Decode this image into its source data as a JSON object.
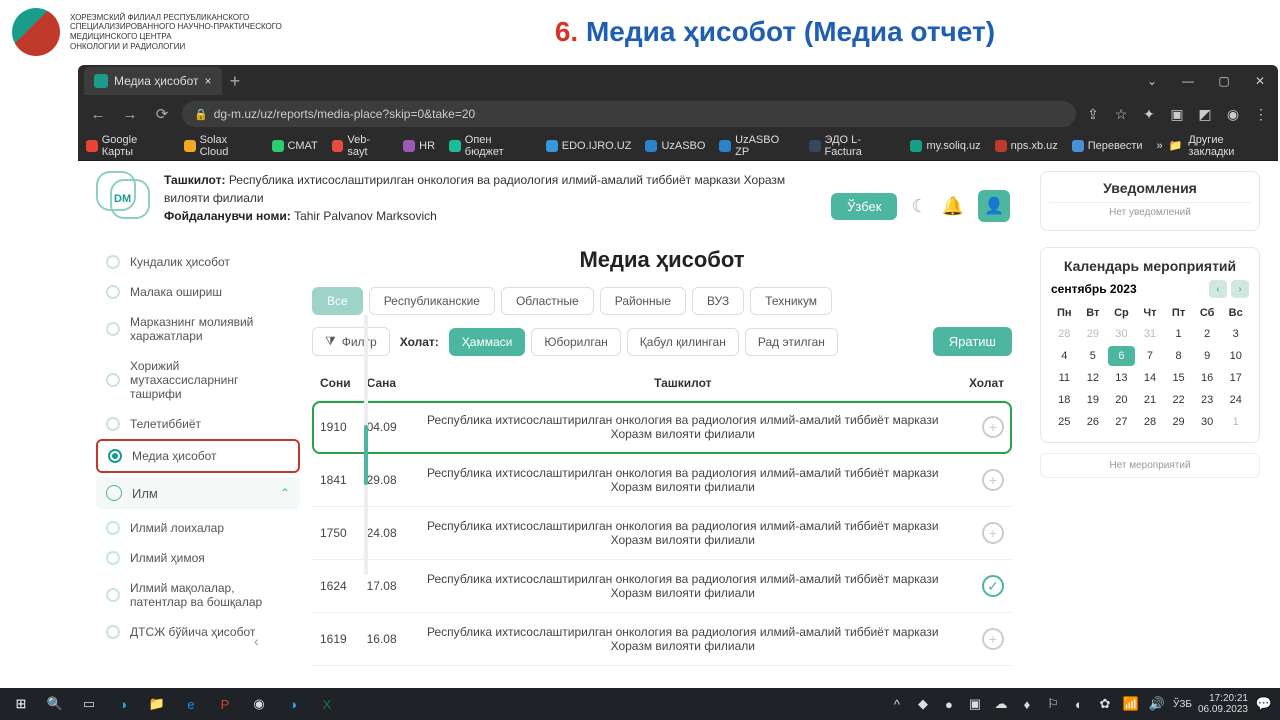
{
  "doc": {
    "org_lines": "ХОРЕЗМСКИЙ ФИЛИАЛ РЕСПУБЛИКАНСКОГО\nСПЕЦИАЛИЗИРОВАННОГО НАУЧНО-ПРАКТИЧЕСКОГО\nМЕДИЦИНСКОГО ЦЕНТРА\nОНКОЛОГИИ И РАДИОЛОГИИ",
    "title_num": "6.",
    "title": "Медиа ҳисобот (Медиа отчет)"
  },
  "browser": {
    "tab_title": "Медиа ҳисобот",
    "url": "dg-m.uz/uz/reports/media-place?skip=0&take=20",
    "bookmarks": [
      {
        "label": "Google Карты",
        "color": "#ea4335"
      },
      {
        "label": "Solax Cloud",
        "color": "#f5a623"
      },
      {
        "label": "СМАТ",
        "color": "#2ecc71"
      },
      {
        "label": "Veb-sayt",
        "color": "#e74c3c"
      },
      {
        "label": "HR",
        "color": "#9b59b6"
      },
      {
        "label": "Опен бюджет",
        "color": "#1abc9c"
      },
      {
        "label": "EDO.IJRO.UZ",
        "color": "#3498db"
      },
      {
        "label": "UzASBO",
        "color": "#2c82c9"
      },
      {
        "label": "UzASBO ZP",
        "color": "#2c82c9"
      },
      {
        "label": "ЭДО L-Factura",
        "color": "#34495e"
      },
      {
        "label": "my.soliq.uz",
        "color": "#16a085"
      },
      {
        "label": "nps.xb.uz",
        "color": "#c0392b"
      },
      {
        "label": "Перевести",
        "color": "#4a90d9"
      }
    ],
    "other_bookmarks": "Другие закладки"
  },
  "app": {
    "org_label": "Ташкилот:",
    "org_value": "Республика ихтисослаштирилган онкология ва радиология илмий-амалий тиббиёт маркази Хоразм вилояти филиали",
    "user_label": "Фойдаланувчи номи:",
    "user_value": "Tahir Palvanov Marksovich",
    "lang": "Ўзбек",
    "notif_title": "Уведомления",
    "notif_empty": "Нет уведомлений",
    "cal_title": "Календарь мероприятий",
    "cal_month": "сентябрь 2023",
    "cal_dow": [
      "Пн",
      "Вт",
      "Ср",
      "Чт",
      "Пт",
      "Сб",
      "Вс"
    ],
    "cal_days": [
      {
        "n": "28",
        "mute": true
      },
      {
        "n": "29",
        "mute": true
      },
      {
        "n": "30",
        "mute": true
      },
      {
        "n": "31",
        "mute": true
      },
      {
        "n": "1"
      },
      {
        "n": "2"
      },
      {
        "n": "3"
      },
      {
        "n": "4"
      },
      {
        "n": "5"
      },
      {
        "n": "6",
        "today": true
      },
      {
        "n": "7"
      },
      {
        "n": "8"
      },
      {
        "n": "9"
      },
      {
        "n": "10"
      },
      {
        "n": "11"
      },
      {
        "n": "12"
      },
      {
        "n": "13"
      },
      {
        "n": "14"
      },
      {
        "n": "15"
      },
      {
        "n": "16"
      },
      {
        "n": "17"
      },
      {
        "n": "18"
      },
      {
        "n": "19"
      },
      {
        "n": "20"
      },
      {
        "n": "21"
      },
      {
        "n": "22"
      },
      {
        "n": "23"
      },
      {
        "n": "24"
      },
      {
        "n": "25"
      },
      {
        "n": "26"
      },
      {
        "n": "27"
      },
      {
        "n": "28"
      },
      {
        "n": "29"
      },
      {
        "n": "30"
      },
      {
        "n": "1",
        "mute": true
      }
    ],
    "cal_empty": "Нет мероприятий"
  },
  "sidebar": {
    "items_top": [
      "Кундалик ҳисобот",
      "Малака ошириш",
      "Марказнинг молиявий харажатлари",
      "Хорижий мутахассисларнинг ташрифи",
      "Телетиббиёт",
      "Медиа ҳисобот"
    ],
    "group": "Илм",
    "items_sub": [
      "Илмий лоихалар",
      "Илмий ҳимоя",
      "Илмий мақолалар, патентлар ва бошқалар",
      "ДТСЖ бўйича ҳисобот"
    ]
  },
  "main": {
    "title": "Медиа ҳисобот",
    "scope_tabs": [
      "Все",
      "Республиканские",
      "Областные",
      "Районные",
      "ВУЗ",
      "Техникум"
    ],
    "filter_label": "Филтр",
    "status_label": "Холат:",
    "status_tabs": [
      "Ҳаммаси",
      "Юборилган",
      "Қабул қилинган",
      "Рад этилган"
    ],
    "create": "Яратиш",
    "cols": {
      "soni": "Сони",
      "sana": "Сана",
      "tashkilot": "Ташкилот",
      "xolat": "Холат"
    },
    "org_name": "Республика ихтисослаштирилган онкология ва радиология илмий-амалий тиббиёт маркази Хоразм вилояти филиали",
    "rows": [
      {
        "soni": "1910",
        "sana": "04.09",
        "status": "plus",
        "hl": true
      },
      {
        "soni": "1841",
        "sana": "29.08",
        "status": "plus"
      },
      {
        "soni": "1750",
        "sana": "24.08",
        "status": "plus"
      },
      {
        "soni": "1624",
        "sana": "17.08",
        "status": "check"
      },
      {
        "soni": "1619",
        "sana": "16.08",
        "status": "plus"
      }
    ]
  },
  "taskbar": {
    "lang": "ЎЗБ",
    "time": "17:20:21",
    "date": "06.09.2023"
  }
}
